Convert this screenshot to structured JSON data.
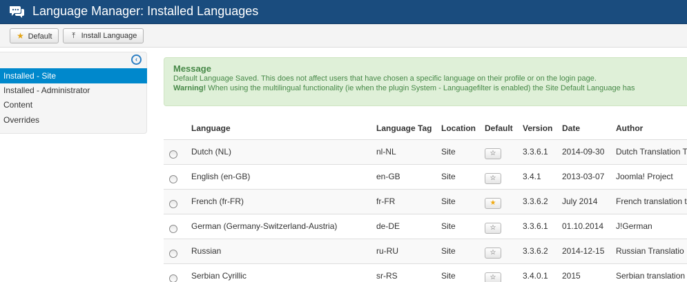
{
  "header": {
    "title": "Language Manager: Installed Languages",
    "logo_icon": "chat-bubbles-icon"
  },
  "toolbar": {
    "default_label": "Default",
    "install_label": "Install Language"
  },
  "sidebar": {
    "toggle_icon": "collapse-left-icon",
    "items": [
      {
        "label": "Installed - Site",
        "active": true
      },
      {
        "label": "Installed - Administrator",
        "active": false
      },
      {
        "label": "Content",
        "active": false
      },
      {
        "label": "Overrides",
        "active": false
      }
    ]
  },
  "alert": {
    "heading": "Message",
    "line1": "Default Language Saved. This does not affect users that have chosen a specific language on their profile or on the login page.",
    "warning_label": "Warning!",
    "line2": " When using the multilingual functionality (ie when the plugin System - Languagefilter is enabled) the Site Default Language has"
  },
  "table": {
    "columns": [
      "Language",
      "Language Tag",
      "Location",
      "Default",
      "Version",
      "Date",
      "Author"
    ],
    "rows": [
      {
        "language": "Dutch (NL)",
        "tag": "nl-NL",
        "location": "Site",
        "default": false,
        "version": "3.3.6.1",
        "date": "2014-09-30",
        "author": "Dutch Translation T"
      },
      {
        "language": "English (en-GB)",
        "tag": "en-GB",
        "location": "Site",
        "default": false,
        "version": "3.4.1",
        "date": "2013-03-07",
        "author": "Joomla! Project"
      },
      {
        "language": "French (fr-FR)",
        "tag": "fr-FR",
        "location": "Site",
        "default": true,
        "version": "3.3.6.2",
        "date": "July 2014",
        "author": "French translation t"
      },
      {
        "language": "German (Germany-Switzerland-Austria)",
        "tag": "de-DE",
        "location": "Site",
        "default": false,
        "version": "3.3.6.1",
        "date": "01.10.2014",
        "author": "J!German"
      },
      {
        "language": "Russian",
        "tag": "ru-RU",
        "location": "Site",
        "default": false,
        "version": "3.3.6.2",
        "date": "2014-12-15",
        "author": "Russian Translatio"
      },
      {
        "language": "Serbian Cyrillic",
        "tag": "sr-RS",
        "location": "Site",
        "default": false,
        "version": "3.4.0.1",
        "date": "2015",
        "author": "Serbian translation"
      }
    ]
  },
  "colors": {
    "header_bg": "#1a4c7e",
    "active_nav": "#0088cc",
    "alert_bg": "#dff0d8",
    "alert_text": "#468847",
    "star_on": "#f0a80c"
  }
}
